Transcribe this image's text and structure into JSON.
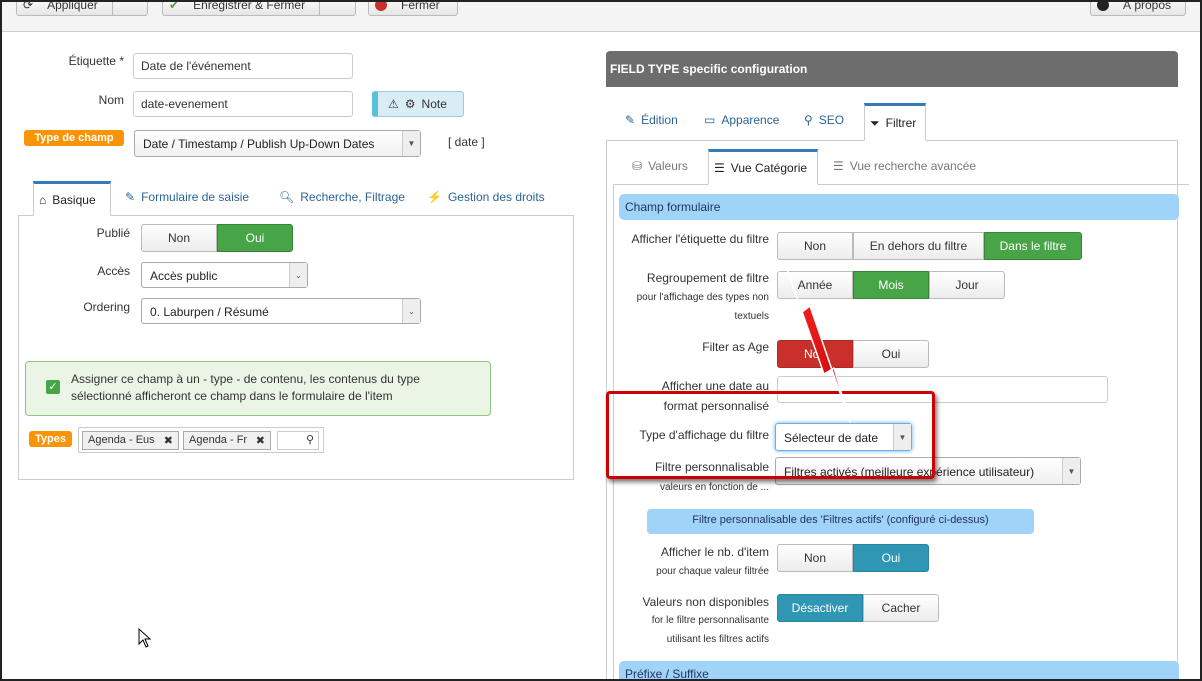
{
  "toolbar": {
    "apply_label": "Appliquer",
    "save_close_label": "Enregistrer & Fermer",
    "close_label": "Fermer",
    "about_label": "À propos"
  },
  "left": {
    "label_field": {
      "label": "Étiquette",
      "required_mark": "*",
      "value": "Date de l'événement"
    },
    "name_field": {
      "label": "Nom",
      "value": "date-evenement"
    },
    "note_button": "Note",
    "type_badge": "Type de champ",
    "type_select": "Date / Timestamp / Publish Up-Down Dates",
    "type_code": "[ date ]",
    "tabs": [
      {
        "label": "Basique",
        "icon": "home-icon"
      },
      {
        "label": "Formulaire de saisie",
        "icon": "edit-icon"
      },
      {
        "label": "Recherche, Filtrage",
        "icon": "search-icon"
      },
      {
        "label": "Gestion des droits",
        "icon": "plug-icon"
      }
    ],
    "published": {
      "label": "Publié",
      "off": "Non",
      "on": "Oui"
    },
    "access": {
      "label": "Accès",
      "value": "Accès public"
    },
    "ordering": {
      "label": "Ordering",
      "value": "0. Laburpen / Résumé"
    },
    "assign_text": "Assigner ce champ à un - type - de contenu, les contenus du type sélectionné afficheront ce champ dans le formulaire de l'item",
    "types_badge": "Types",
    "types_tags": [
      "Agenda - Eus",
      "Agenda - Fr"
    ]
  },
  "right": {
    "header": "FIELD TYPE specific configuration",
    "tabs": [
      {
        "label": "Édition",
        "icon": "edit-icon"
      },
      {
        "label": "Apparence",
        "icon": "monitor-icon"
      },
      {
        "label": "SEO",
        "icon": "search-icon"
      },
      {
        "label": "Filtrer",
        "icon": "filter-icon"
      }
    ],
    "subtabs": [
      {
        "label": "Valeurs",
        "icon": "database-icon"
      },
      {
        "label": "Vue Catégorie",
        "icon": "list-icon"
      },
      {
        "label": "Vue recherche avancée",
        "icon": "list-icon"
      }
    ],
    "section1": "Champ formulaire",
    "rows": {
      "show_label": {
        "label": "Afficher l'étiquette du filtre",
        "opts": [
          "Non",
          "En dehors du filtre",
          "Dans le filtre"
        ]
      },
      "grouping": {
        "label": "Regroupement de filtre",
        "sub1": "pour l'affichage des types non",
        "sub2": "textuels",
        "opts": [
          "Année",
          "Mois",
          "Jour"
        ]
      },
      "filter_age": {
        "label": "Filter as Age",
        "opts": [
          "Non",
          "Oui"
        ]
      },
      "custom_date": {
        "label1": "Afficher une date au",
        "label2": "format personnalisé"
      },
      "display_type": {
        "label": "Type d'affichage du filtre",
        "value": "Sélecteur de date"
      },
      "custom_filter": {
        "label": "Filtre personnalisable",
        "sub": "valeurs en fonction de ...",
        "value": "Filtres activés (meilleure expérience utilisateur)"
      },
      "active_note": "Filtre personnalisable des 'Filtres actifs' (configuré ci-dessus)",
      "show_count": {
        "label": "Afficher le nb. d'item",
        "sub": "pour chaque valeur filtrée",
        "opts": [
          "Non",
          "Oui"
        ]
      },
      "unavailable": {
        "label": "Valeurs non disponibles",
        "sub1": "for le filtre personnalisante",
        "sub2": "utilisant les filtres actifs",
        "opts": [
          "Désactiver",
          "Cacher"
        ]
      }
    },
    "section2": "Préfixe / Suffixe"
  },
  "colors": {
    "green": "#47a447",
    "red": "#c9302c",
    "teal": "#2f96b4",
    "orange": "#f89406",
    "highlight_box": "#cc0000"
  }
}
